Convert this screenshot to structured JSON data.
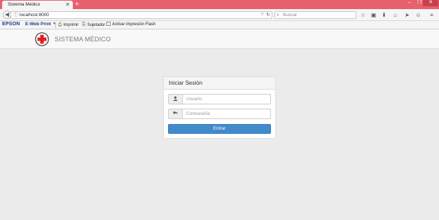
{
  "browser": {
    "tab_title": "Sistema Médico",
    "tab_close": "✕",
    "new_tab": "+",
    "window_controls": {
      "minimize": "–",
      "maximize": "❐",
      "close": "✕"
    },
    "url": "localhost:8000",
    "search_placeholder": "Buscar",
    "nav_icons": [
      "star-icon",
      "library-icon",
      "download-icon",
      "home-icon",
      "send-icon",
      "chat-icon",
      "menu-icon"
    ]
  },
  "bookmarks": {
    "epson": "EPSON",
    "ewebprint": "E-Web Print",
    "imprimir": "Imprimir",
    "sujetador": "Sujetador",
    "flash": "Activar impresión Flash"
  },
  "app": {
    "brand": "SISTEMA MÉDICO",
    "brand_color": "#e02020"
  },
  "login": {
    "title": "Iniciar Sesión",
    "username_placeholder": "Usuario",
    "password_placeholder": "Contraseña",
    "submit_label": "Entrar",
    "button_color": "#428bca"
  }
}
